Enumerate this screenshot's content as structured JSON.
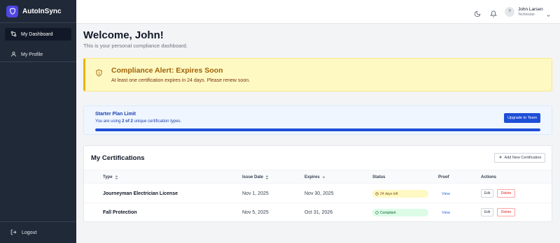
{
  "app": {
    "name": "AutoInSync"
  },
  "sidebar": {
    "items": [
      {
        "label": "My Dashboard",
        "icon": "dashboard-icon",
        "active": true
      },
      {
        "label": "My Profile",
        "icon": "user-icon",
        "active": false
      }
    ],
    "logout_label": "Logout"
  },
  "header": {
    "user": {
      "name": "John Larsen",
      "role": "Technician",
      "avatar_text": "?"
    }
  },
  "main": {
    "title": "Welcome, John!",
    "subtitle": "This is your personal compliance dashboard."
  },
  "alert": {
    "title": "Compliance Alert: Expires Soon",
    "text": "At least one certification expires in 24 days. Please renew soon."
  },
  "plan": {
    "title": "Starter Plan Limit",
    "text_prefix": "You are using",
    "used": "2 of 2",
    "text_suffix": "unique certification types.",
    "button": "Upgrade to Team",
    "progress_fraction": 1.0
  },
  "certifications": {
    "title": "My Certifications",
    "add_button": "Add New Certification",
    "columns": {
      "type": "Type",
      "issue_date": "Issue Date",
      "expires": "Expires",
      "status": "Status",
      "proof": "Proof",
      "actions": "Actions"
    },
    "rows": [
      {
        "type": "Journeyman Electrician License",
        "issue_date": "Nov 1, 2025",
        "expires": "Nov 30, 2025",
        "status": "24 days left",
        "proof": "View",
        "edit": "Edit",
        "delete": "Delete"
      },
      {
        "type": "Fall Protection",
        "issue_date": "Nov 5, 2025",
        "expires": "Oct 31, 2026",
        "status": "Compliant",
        "proof": "View",
        "edit": "Edit",
        "delete": "Delete"
      }
    ]
  },
  "colors": {
    "sidebar_bg": "#1f2937",
    "brand_accent": "#4f46e5",
    "alert_bg": "#fef9c3",
    "alert_title": "#a16207",
    "plan_accent": "#1d4ed8",
    "status_warn": "#fef9c3",
    "status_ok": "#dcfce7",
    "danger": "#dc2626"
  }
}
